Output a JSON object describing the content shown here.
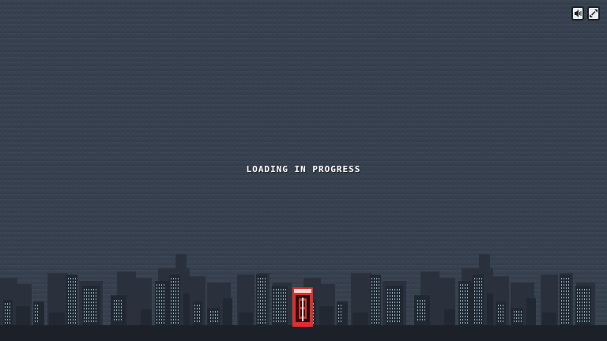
{
  "loading": {
    "text": "LOADING IN PROGRESS"
  },
  "controls": {
    "sound_icon": "speaker-icon",
    "fullscreen_icon": "fullscreen-toggle-icon"
  },
  "colors": {
    "background": "#36404e",
    "building_back": "#2a313c",
    "building_front": "#222831",
    "window": "#8fb3c8",
    "ground": "#1c2028",
    "phone_booth": "#d8322c"
  }
}
